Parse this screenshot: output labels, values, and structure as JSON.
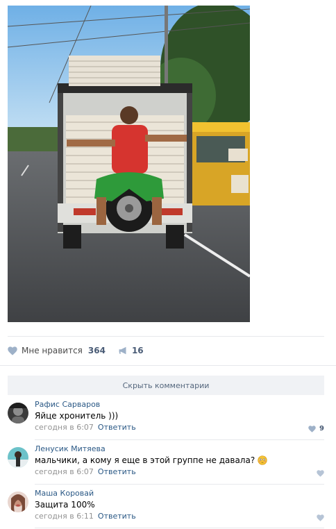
{
  "post": {
    "actions": {
      "like_label": "Мне нравится",
      "like_count": "364",
      "share_count": "16"
    },
    "hide_comments_label": "Скрыть комментарии"
  },
  "comments": [
    {
      "author": "Рафис Сарваров",
      "text": "Яйце хронитель )))",
      "time": "сегодня в 6:07",
      "reply_label": "Ответить",
      "likes": "9"
    },
    {
      "author": "Ленусик Митяева",
      "text": "мальчики, а кому я еще в этой группе не давала?",
      "time": "сегодня в 6:07",
      "reply_label": "Ответить",
      "likes": ""
    },
    {
      "author": "Маша Коровай",
      "text": "Защита 100%",
      "time": "сегодня в 6:11",
      "reply_label": "Ответить",
      "likes": ""
    }
  ],
  "colors": {
    "link": "#2a5885",
    "muted": "#939393",
    "bar_bg": "#f0f2f5",
    "like_icon": "#9eb1c8"
  },
  "icons": {
    "like": "heart-icon",
    "share": "megaphone-icon",
    "emoji": "flushed-face-emoji"
  }
}
